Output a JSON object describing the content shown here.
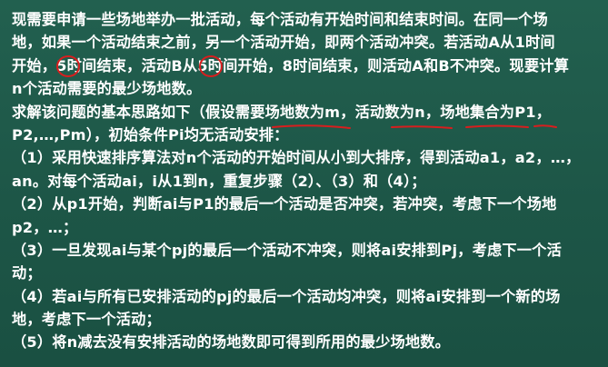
{
  "problem": {
    "lines": [
      "现需要申请一些场地举办一批活动，每个活动有开始时间和结束时间。在同一个场",
      "地，如果一个活动结束之前，另一个活动开始，即两个活动冲突。若活动A从1时间",
      "开始，5时间结束，活动B从5时间开始，8时间结束，则活动A和B不冲突。现要计算",
      "n个活动需要的最少场地数。"
    ]
  },
  "solution": {
    "lines": [
      "求解该问题的基本思路如下（假设需要场地数为m，活动数为n，场地集合为P1，",
      "P2,…,Pm），初始条件Pi均无活动安排：",
      "（1）采用快速排序算法对n个活动的开始时间从小到大排序，得到活动a1，a2，…，",
      "an。对每个活动ai，i从1到n，重复步骤（2）、（3）和（4）；",
      "（2）从p1开始，判断ai与P1的最后一个活动是否冲突，若冲突，考虑下一个场地",
      "p2，…；",
      "（3）一旦发现ai与某个pj的最后一个活动不冲突，则将ai安排到Pj，考虑下一个活",
      "动；",
      "（4）若ai与所有已安排活动的pj的最后一个活动均冲突，则将ai安排到一个新的场",
      "地，考虑下一个活动；",
      "（5）将n减去没有安排活动的场地数即可得到所用的最少场地数。"
    ]
  },
  "annotation_color": "#d81e1e"
}
